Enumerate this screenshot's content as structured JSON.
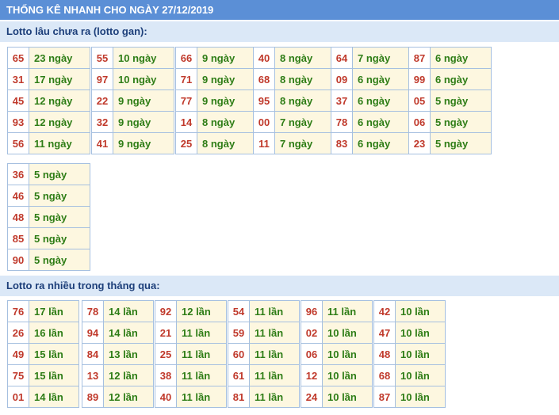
{
  "title": "THỐNG KÊ NHANH CHO NGÀY 27/12/2019",
  "sections": {
    "gan": {
      "heading": "Lotto lâu chưa ra (lotto gan):",
      "blocks": [
        [
          [
            "65",
            "23 ngày"
          ],
          [
            "31",
            "17 ngày"
          ],
          [
            "45",
            "12 ngày"
          ],
          [
            "93",
            "12 ngày"
          ],
          [
            "56",
            "11 ngày"
          ]
        ],
        [
          [
            "55",
            "10 ngày"
          ],
          [
            "97",
            "10 ngày"
          ],
          [
            "22",
            "9 ngày"
          ],
          [
            "32",
            "9 ngày"
          ],
          [
            "41",
            "9 ngày"
          ]
        ],
        [
          [
            "66",
            "9 ngày"
          ],
          [
            "71",
            "9 ngày"
          ],
          [
            "77",
            "9 ngày"
          ],
          [
            "14",
            "8 ngày"
          ],
          [
            "25",
            "8 ngày"
          ]
        ],
        [
          [
            "40",
            "8 ngày"
          ],
          [
            "68",
            "8 ngày"
          ],
          [
            "95",
            "8 ngày"
          ],
          [
            "00",
            "7 ngày"
          ],
          [
            "11",
            "7 ngày"
          ]
        ],
        [
          [
            "64",
            "7 ngày"
          ],
          [
            "09",
            "6 ngày"
          ],
          [
            "37",
            "6 ngày"
          ],
          [
            "78",
            "6 ngày"
          ],
          [
            "83",
            "6 ngày"
          ]
        ],
        [
          [
            "87",
            "6 ngày"
          ],
          [
            "99",
            "6 ngày"
          ],
          [
            "05",
            "5 ngày"
          ],
          [
            "06",
            "5 ngày"
          ],
          [
            "23",
            "5 ngày"
          ]
        ],
        [
          [
            "36",
            "5 ngày"
          ],
          [
            "46",
            "5 ngày"
          ],
          [
            "48",
            "5 ngày"
          ],
          [
            "85",
            "5 ngày"
          ],
          [
            "90",
            "5 ngày"
          ]
        ]
      ]
    },
    "nhieu": {
      "heading": "Lotto ra nhiều trong tháng qua:",
      "blocks": [
        [
          [
            "76",
            "17 lần"
          ],
          [
            "26",
            "16 lần"
          ],
          [
            "49",
            "15 lần"
          ],
          [
            "75",
            "15 lần"
          ],
          [
            "01",
            "14 lần"
          ]
        ],
        [
          [
            "78",
            "14 lần"
          ],
          [
            "94",
            "14 lần"
          ],
          [
            "84",
            "13 lần"
          ],
          [
            "13",
            "12 lần"
          ],
          [
            "89",
            "12 lần"
          ]
        ],
        [
          [
            "92",
            "12 lần"
          ],
          [
            "21",
            "11 lần"
          ],
          [
            "25",
            "11 lần"
          ],
          [
            "38",
            "11 lần"
          ],
          [
            "40",
            "11 lần"
          ]
        ],
        [
          [
            "54",
            "11 lần"
          ],
          [
            "59",
            "11 lần"
          ],
          [
            "60",
            "11 lần"
          ],
          [
            "61",
            "11 lần"
          ],
          [
            "81",
            "11 lần"
          ]
        ],
        [
          [
            "96",
            "11 lần"
          ],
          [
            "02",
            "10 lần"
          ],
          [
            "06",
            "10 lần"
          ],
          [
            "12",
            "10 lần"
          ],
          [
            "24",
            "10 lần"
          ]
        ],
        [
          [
            "42",
            "10 lần"
          ],
          [
            "47",
            "10 lần"
          ],
          [
            "48",
            "10 lần"
          ],
          [
            "68",
            "10 lần"
          ],
          [
            "87",
            "10 lần"
          ]
        ]
      ]
    }
  }
}
